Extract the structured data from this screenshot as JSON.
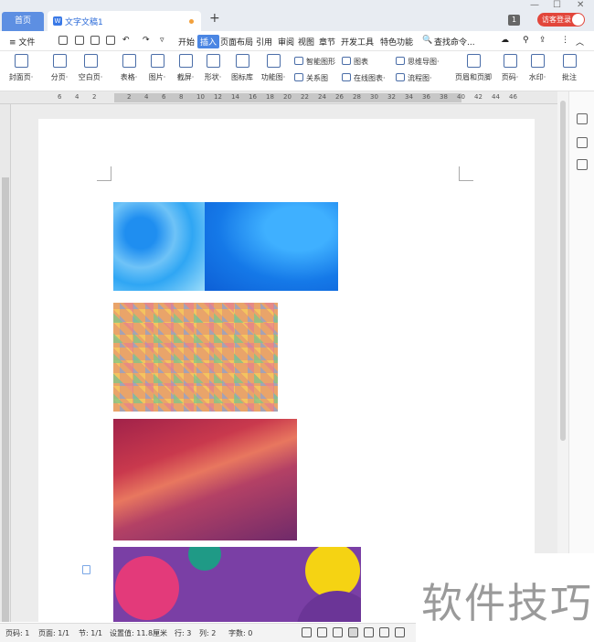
{
  "titlebar": {
    "home_tab": "首页",
    "doc_tab": "文字文稿1",
    "new_tab": "+",
    "window_controls": [
      "—",
      "☐",
      "✕"
    ],
    "badge": "1",
    "login": "访客登录"
  },
  "menu": {
    "file": "≡ 文件",
    "tabs": [
      "开始",
      "插入",
      "页面布局",
      "引用",
      "审阅",
      "视图",
      "章节",
      "开发工具",
      "特色功能"
    ],
    "active_tab": "插入",
    "search": "查找命令..."
  },
  "ribbon": {
    "items": [
      {
        "label": "封面页·",
        "icon": "cover-page-icon"
      },
      {
        "label": "分页·",
        "icon": "page-break-icon"
      },
      {
        "label": "空白页·",
        "icon": "blank-page-icon"
      },
      {
        "label": "表格·",
        "icon": "table-icon"
      },
      {
        "label": "图片·",
        "icon": "picture-icon"
      },
      {
        "label": "截屏·",
        "icon": "screenshot-icon"
      },
      {
        "label": "形状·",
        "icon": "shape-icon"
      },
      {
        "label": "图标库",
        "icon": "icon-library-icon"
      },
      {
        "label": "功能图·",
        "icon": "function-chart-icon"
      },
      {
        "label": "页眉和页脚",
        "icon": "header-footer-icon"
      },
      {
        "label": "页码·",
        "icon": "page-number-icon"
      },
      {
        "label": "水印·",
        "icon": "watermark-icon"
      },
      {
        "label": "批注",
        "icon": "comment-icon"
      }
    ],
    "small": [
      "智能图形",
      "图表",
      "思维导图·",
      "关系图",
      "在线图表·",
      "流程图·"
    ]
  },
  "ruler": {
    "h_labels": [
      "6",
      "4",
      "2",
      "",
      "2",
      "4",
      "6",
      "8",
      "10",
      "12",
      "14",
      "16",
      "18",
      "20",
      "22",
      "24",
      "26",
      "28",
      "30",
      "32",
      "34",
      "36",
      "38",
      "40",
      "42",
      "44",
      "46"
    ]
  },
  "status": {
    "page_code": "页码: 1",
    "pages": "页面: 1/1",
    "section": "节: 1/1",
    "setting": "设置值: 11.8厘米",
    "row": "行: 3",
    "col": "列: 2",
    "words": "字数: 0"
  },
  "watermark": {
    "text": "软件技巧"
  }
}
